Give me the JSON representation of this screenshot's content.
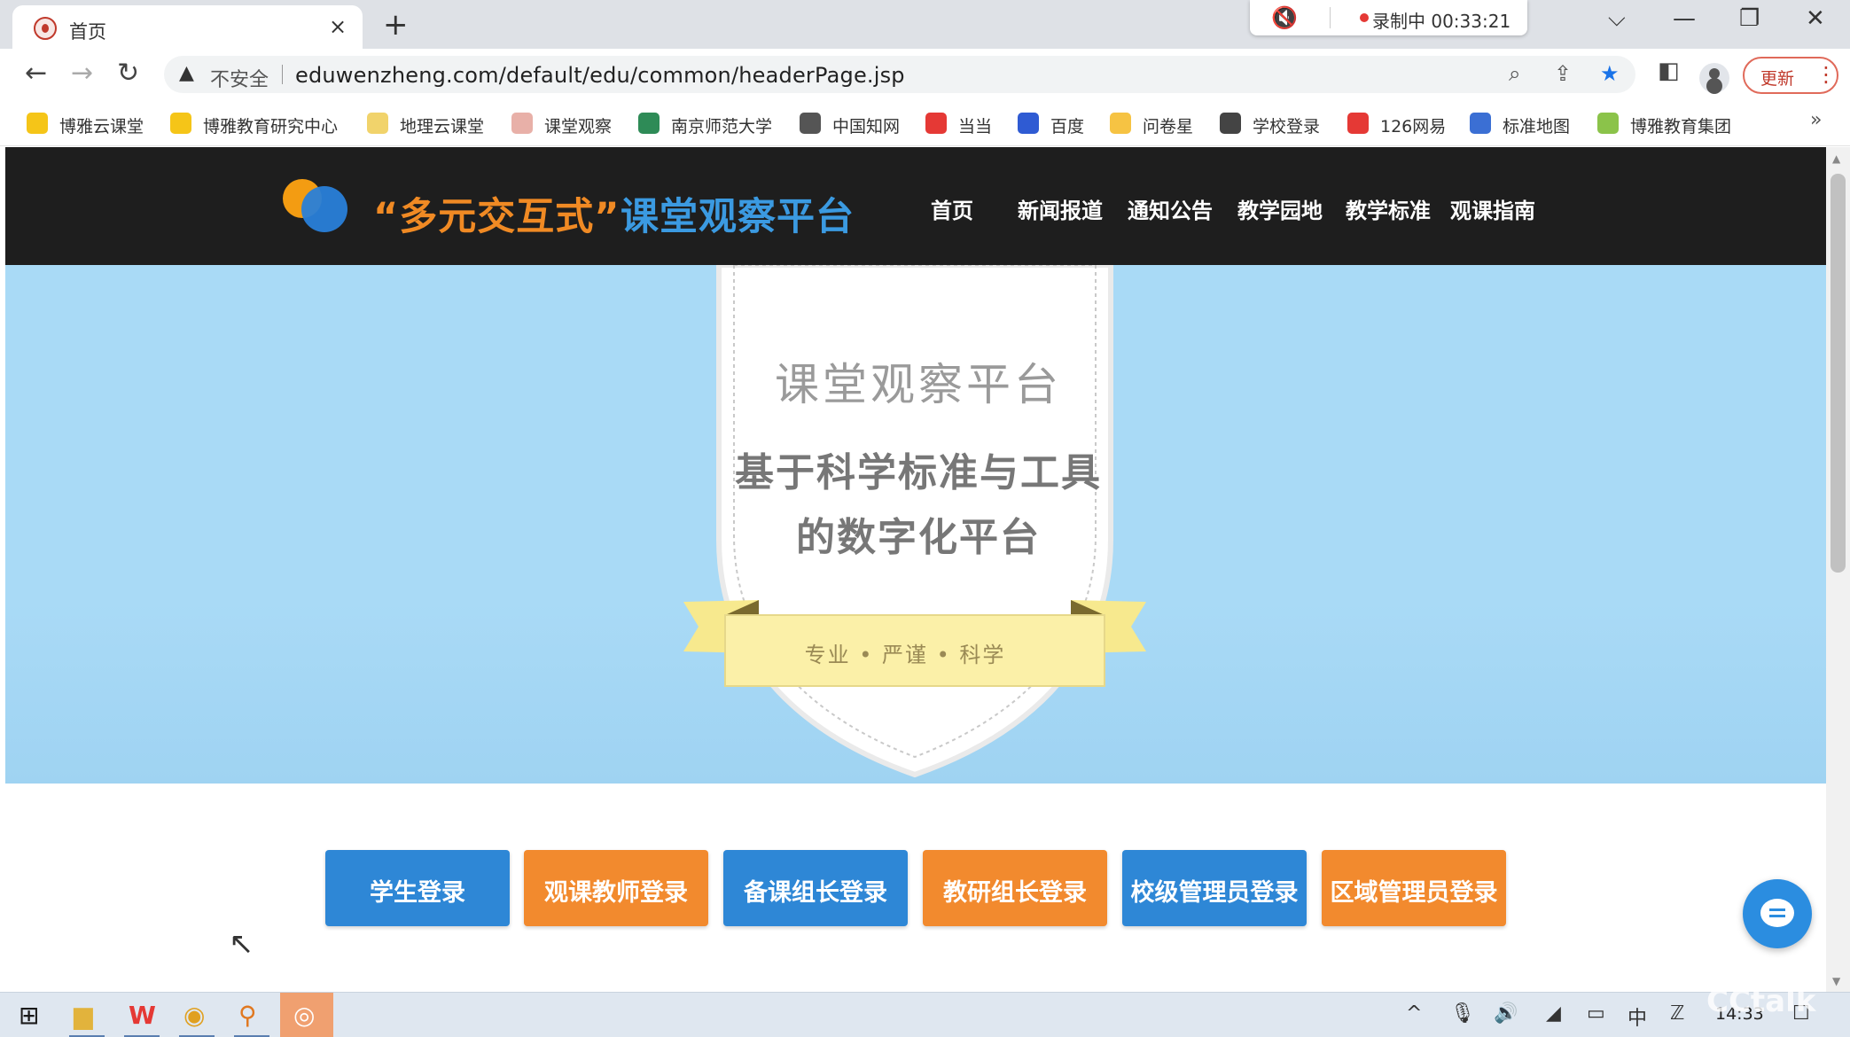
{
  "browser": {
    "tab": {
      "title": "首页",
      "close_icon": "×",
      "new_tab_icon": "+"
    },
    "recorder": {
      "label": "录制中 00:33:21"
    },
    "window_controls": {
      "tab_search": "⌵",
      "minimize": "—",
      "restore": "❐",
      "close": "✕"
    },
    "toolbar": {
      "back": "←",
      "forward": "→",
      "reload": "↻",
      "security_icon": "▲",
      "security_label": "不安全",
      "url": "eduwenzheng.com/default/edu/common/headerPage.jsp",
      "zoom_icon": "⌕",
      "share_icon": "⇪",
      "star_icon": "★",
      "sidepanel_icon": "◧",
      "update_label": "更新",
      "menu_icon": "⋮"
    },
    "bookmarks": [
      {
        "label": "博雅云课堂",
        "color": "#f5c518"
      },
      {
        "label": "博雅教育研究中心",
        "color": "#f5c518"
      },
      {
        "label": "地理云课堂",
        "color": "#f1d36b"
      },
      {
        "label": "课堂观察",
        "color": "#e8b0a8"
      },
      {
        "label": "南京师范大学",
        "color": "#2e8b57"
      },
      {
        "label": "中国知网",
        "color": "#555555"
      },
      {
        "label": "当当",
        "color": "#e53935"
      },
      {
        "label": "百度",
        "color": "#2f5bd3"
      },
      {
        "label": "问卷星",
        "color": "#f6c343"
      },
      {
        "label": "学校登录",
        "color": "#444444"
      },
      {
        "label": "126网易",
        "color": "#e53935"
      },
      {
        "label": "标准地图",
        "color": "#3b6fd4"
      },
      {
        "label": "博雅教育集团",
        "color": "#8bc34a"
      }
    ],
    "bookmarks_more": "»"
  },
  "site": {
    "title_quoted": "“多元交互式”",
    "title_platform": "课堂观察平台",
    "nav": [
      "首页",
      "新闻报道",
      "通知公告",
      "教学园地",
      "教学标准",
      "观课指南"
    ],
    "hero": {
      "shield_title": "课堂观察平台",
      "line1": "基于科学标准与工具",
      "line2": "的数字化平台",
      "ribbon": "专业 • 严谨 • 科学"
    },
    "login_buttons": [
      {
        "label": "学生登录",
        "color": "blue"
      },
      {
        "label": "观课教师登录",
        "color": "orange"
      },
      {
        "label": "备课组长登录",
        "color": "blue"
      },
      {
        "label": "教研组长登录",
        "color": "orange"
      },
      {
        "label": "校级管理员登录",
        "color": "blue"
      },
      {
        "label": "区域管理员登录",
        "color": "orange"
      }
    ]
  },
  "taskbar": {
    "start_icon": "⊞",
    "tray": {
      "chevron": "^",
      "mic": "🎙",
      "volume": "🔊",
      "network": "◢",
      "battery": "▭",
      "ime": "中",
      "ime2": "ℤ"
    },
    "clock": "14:33",
    "notification_icon": "☐",
    "watermark": "CCtalk"
  },
  "colors": {
    "header_bg": "#1e1e1e",
    "hero_bg": "#a9daf6",
    "accent_blue": "#2e87d6",
    "accent_orange": "#f28a2e"
  }
}
